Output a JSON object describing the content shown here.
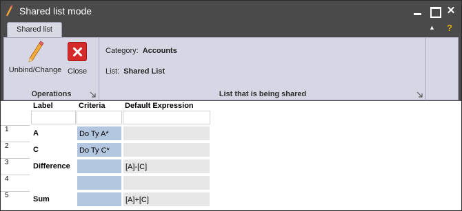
{
  "window": {
    "title": "Shared list mode"
  },
  "tabs": [
    {
      "label": "Shared list"
    }
  ],
  "help_label": "?",
  "ribbon": {
    "operations": {
      "label": "Operations",
      "buttons": [
        {
          "label": "Unbind/Change",
          "icon": "pencil-icon"
        },
        {
          "label": "Close",
          "icon": "close-icon"
        }
      ]
    },
    "shared_list": {
      "label": "List that is being shared",
      "category_label": "Category:",
      "category_value": "Accounts",
      "list_label": "List:",
      "list_value": "Shared List"
    }
  },
  "grid": {
    "columns": [
      "Label",
      "Criteria",
      "Default Expression"
    ],
    "rows": [
      {
        "num": "1",
        "label": "A",
        "criteria": "Do Ty A*",
        "expression": ""
      },
      {
        "num": "2",
        "label": "C",
        "criteria": "Do Ty C*",
        "expression": ""
      },
      {
        "num": "3",
        "label": "Difference",
        "criteria": "",
        "expression": "[A]-[C]"
      },
      {
        "num": "4",
        "label": "",
        "criteria": "",
        "expression": ""
      },
      {
        "num": "5",
        "label": "Sum",
        "criteria": "",
        "expression": "[A]+[C]"
      }
    ]
  },
  "colors": {
    "titlebar": "#4a4a4a",
    "ribbon": "#d6d6e4",
    "criteria_cell": "#b3c6df",
    "expression_cell": "#e6e6e6",
    "close_button": "#d52a2a"
  }
}
